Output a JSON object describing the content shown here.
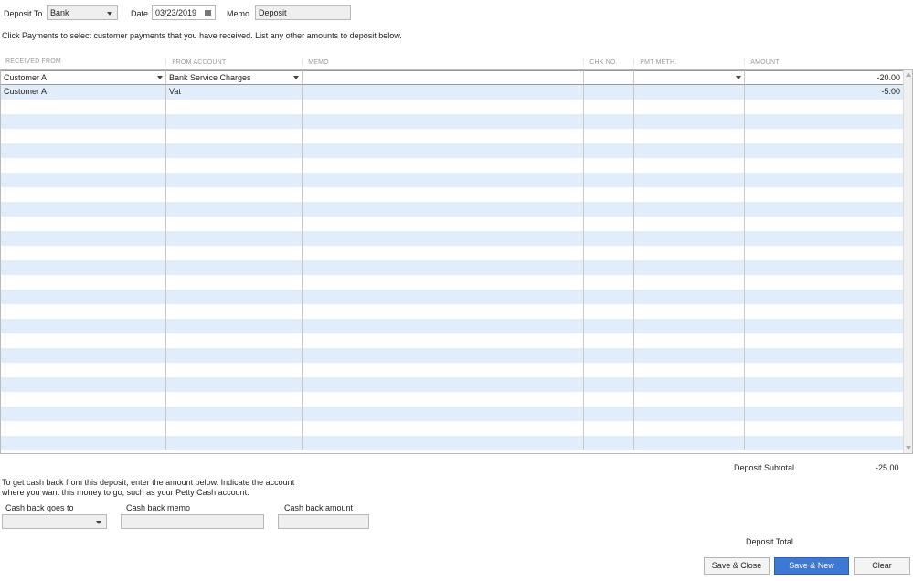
{
  "header": {
    "deposit_to_label": "Deposit To",
    "deposit_to_value": "Bank",
    "date_label": "Date",
    "date_value": "03/23/2019",
    "memo_label": "Memo",
    "memo_value": "Deposit"
  },
  "instructions": "Click Payments to select customer payments that you have received. List any other amounts to deposit below.",
  "columns": [
    "RECEIVED FROM",
    "FROM ACCOUNT",
    "MEMO",
    "CHK NO.",
    "PMT METH.",
    "AMOUNT"
  ],
  "rows": [
    {
      "received_from": "Customer A",
      "from_account": "Bank Service Charges",
      "memo": "",
      "chk_no": "",
      "pmt_meth": "",
      "amount": "-20.00"
    },
    {
      "received_from": "Customer A",
      "from_account": "Vat",
      "memo": "",
      "chk_no": "",
      "pmt_meth": "",
      "amount": "-5.00"
    }
  ],
  "subtotal": {
    "label": "Deposit Subtotal",
    "value": "-25.00"
  },
  "cashback": {
    "text1": "To get cash back from this deposit, enter the amount below.  Indicate the account",
    "text2": "where you want this money to go, such as your Petty Cash account.",
    "goes_to_label": "Cash back goes to",
    "memo_label": "Cash back memo",
    "amount_label": "Cash back amount"
  },
  "total": {
    "label": "Deposit Total"
  },
  "buttons": {
    "save_close": "Save & Close",
    "save_new": "Save & New",
    "clear": "Clear"
  }
}
